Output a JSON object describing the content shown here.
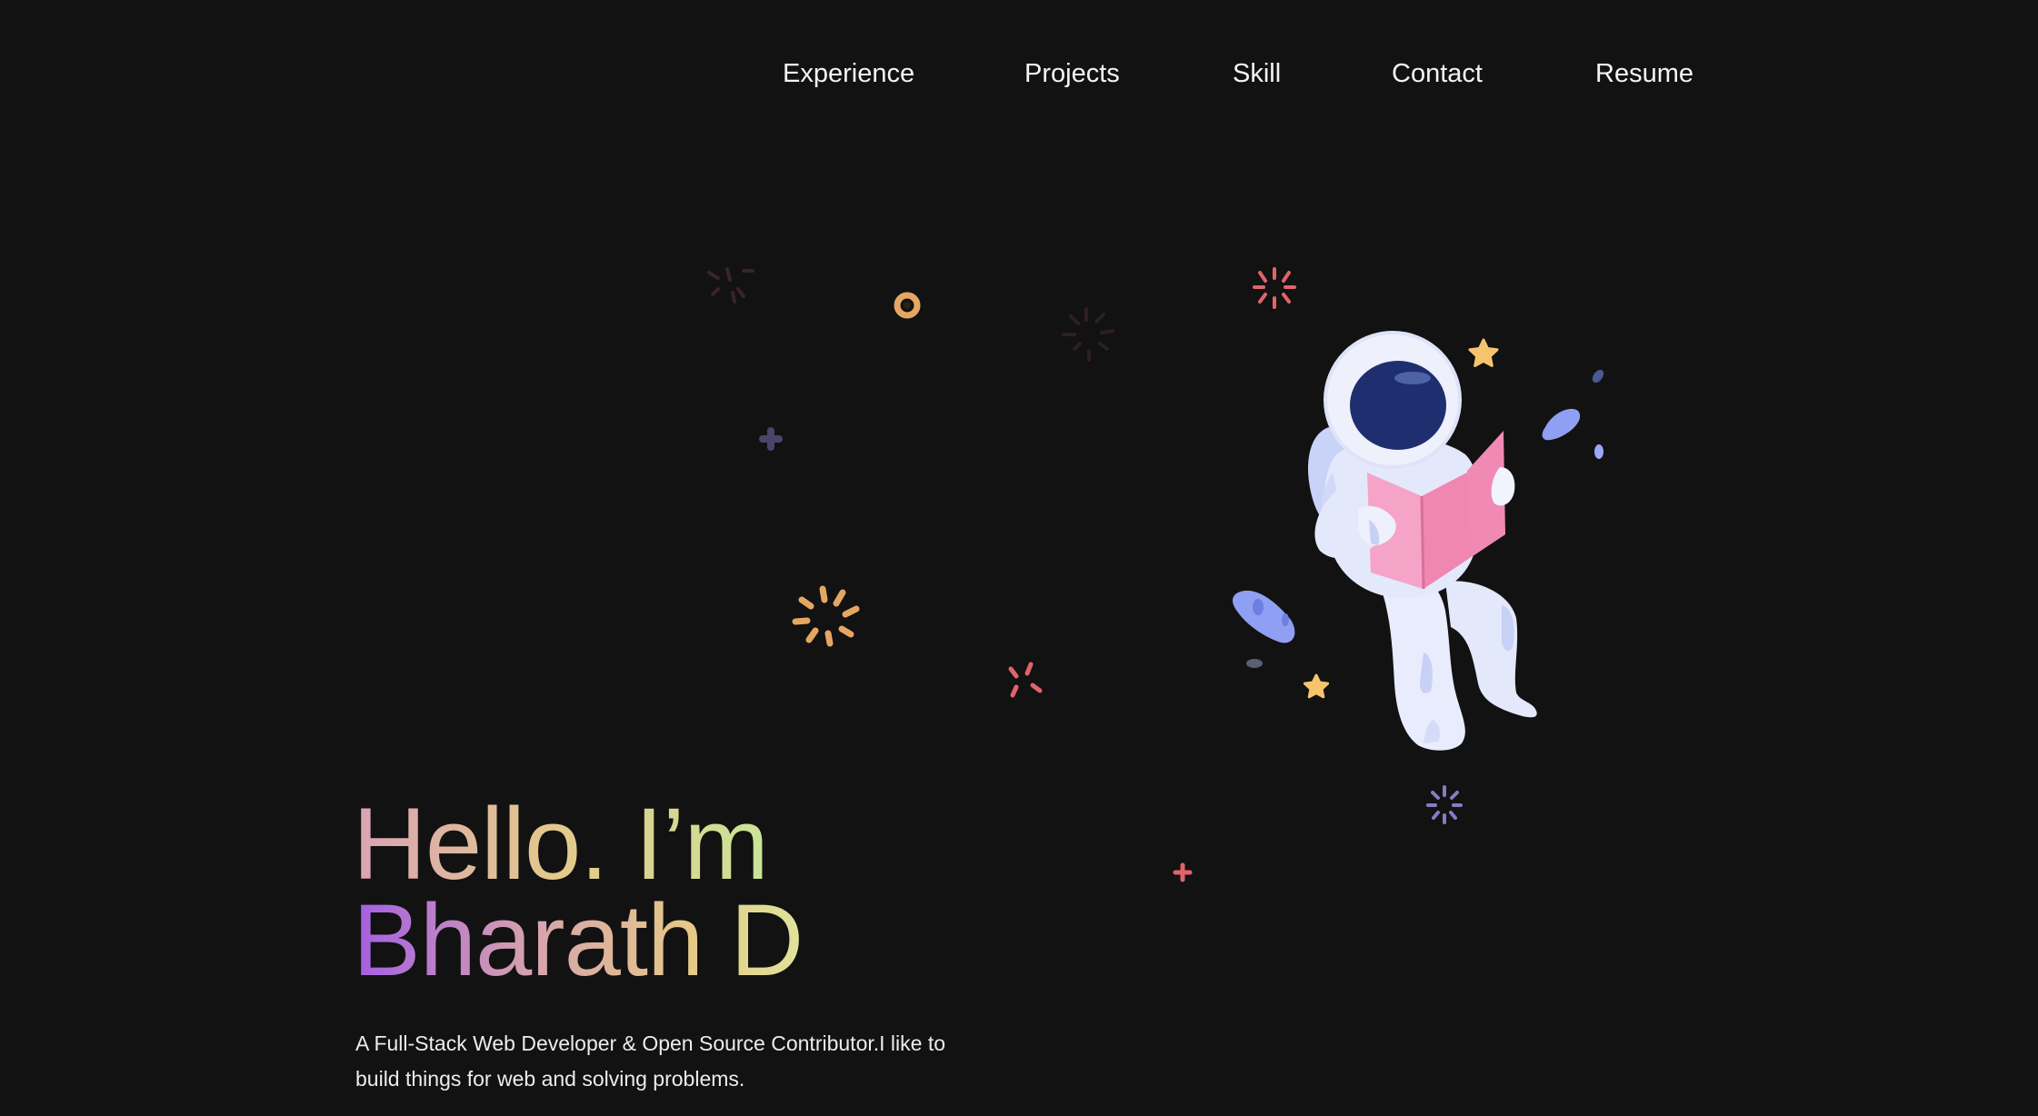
{
  "nav": {
    "items": [
      {
        "id": "experience",
        "label": "Experience"
      },
      {
        "id": "projects",
        "label": "Projects"
      },
      {
        "id": "skill",
        "label": "Skill"
      },
      {
        "id": "contact",
        "label": "Contact"
      },
      {
        "id": "resume",
        "label": "Resume"
      }
    ]
  },
  "hero": {
    "greeting": "Hello. I’m",
    "name": "Bharath D",
    "description": "A Full-Stack Web Developer & Open Source Contributor.I like to build things for web and solving problems."
  },
  "illustration": {
    "subject": "astronaut-reading-book",
    "colors": {
      "suit": "#e4e8fb",
      "visor": "#1f2e6e",
      "book": "#f08ab4",
      "star": "#f7c46e",
      "rock": "#8f9ff3",
      "sparkle_red": "#e0646a",
      "sparkle_orange": "#e6a663",
      "sparkle_purple": "#8a7ac4"
    }
  }
}
